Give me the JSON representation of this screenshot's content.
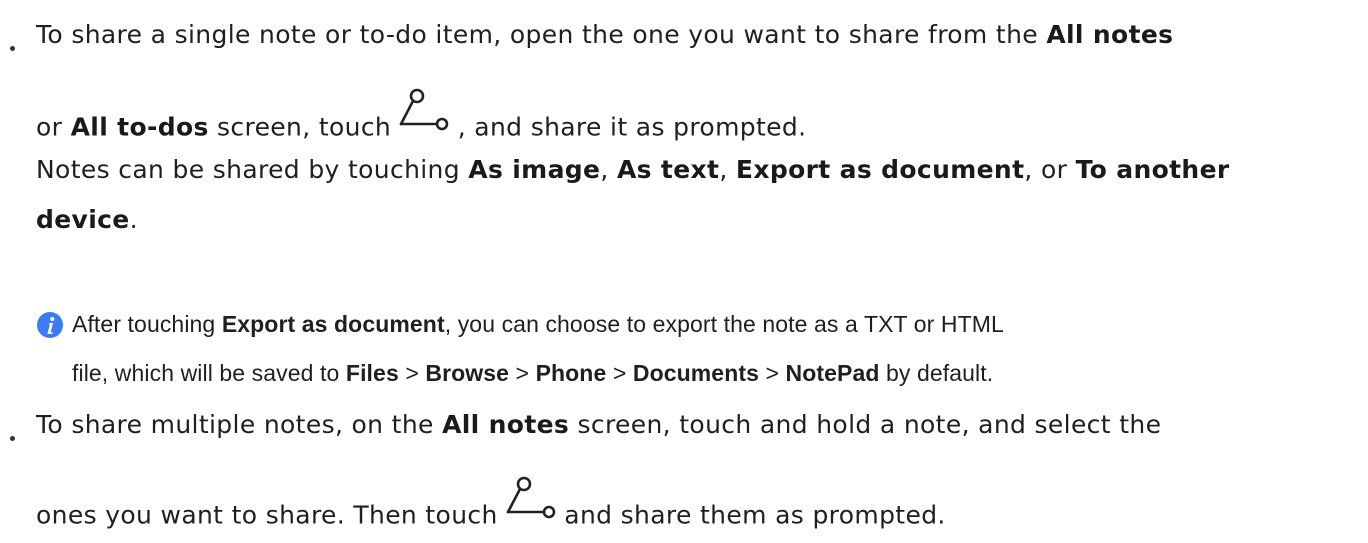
{
  "bullet1": {
    "line1": {
      "t1": "To share a single note or to-do item, open the one you want to share from the ",
      "b1": "All notes"
    },
    "line2": {
      "t1": "or ",
      "b1": "All to-dos",
      "t2": " screen, touch ",
      "t3": " , and share it as prompted."
    },
    "line3": {
      "t1": "Notes can be shared by touching ",
      "b1": "As image",
      "t2": ", ",
      "b2": "As text",
      "t3": ", ",
      "b3": "Export as document",
      "t4": ", or ",
      "b4": "To another"
    },
    "line4": {
      "b1": "device",
      "t1": "."
    }
  },
  "note": {
    "line1": {
      "t1": "After touching ",
      "b1": "Export as document",
      "t2": ", you can choose to export the note as a TXT or HTML"
    },
    "line2": {
      "t1": "file, which will be saved to ",
      "b1": "Files",
      "s1": " > ",
      "b2": "Browse",
      "s2": " > ",
      "b3": "Phone",
      "s3": " > ",
      "b4": "Documents",
      "s4": " > ",
      "b5": "NotePad",
      "t2": " by default."
    }
  },
  "bullet2": {
    "line1": {
      "t1": "To share multiple notes, on the ",
      "b1": "All notes",
      "t2": " screen, touch and hold a note, and select the"
    },
    "line2": {
      "t1": "ones you want to share. Then touch ",
      "t2": " and share them as prompted."
    }
  },
  "icons": {
    "share": "share-icon",
    "info": "info-icon"
  },
  "colors": {
    "info_icon": "#3b7cf6",
    "text": "#1f1f1f"
  }
}
